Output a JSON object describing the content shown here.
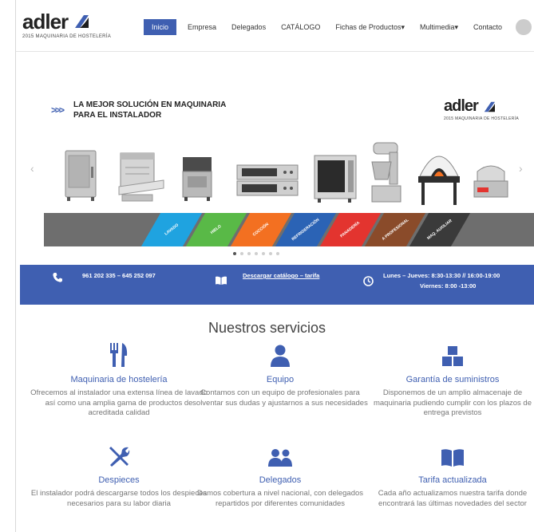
{
  "brand": {
    "name": "adler",
    "tagline": "2015 MAQUINARIA DE HOSTELERÍA"
  },
  "nav": {
    "items": [
      {
        "label": "Inicio",
        "active": true
      },
      {
        "label": "Empresa"
      },
      {
        "label": "Delegados"
      },
      {
        "label": "CATÁLOGO"
      },
      {
        "label": "Fichas de Productos▾"
      },
      {
        "label": "Multimedia▾"
      },
      {
        "label": "Contacto"
      }
    ]
  },
  "banner": {
    "headline_line1": "LA MEJOR SOLUCIÓN EN MAQUINARIA",
    "headline_line2": "PARA EL INSTALADOR",
    "chevrons": ">>>",
    "categories": [
      {
        "label": "LAVADO",
        "color": "#1fa3e0"
      },
      {
        "label": "HIELO",
        "color": "#59b947"
      },
      {
        "label": "COCCIÓN",
        "color": "#f37021"
      },
      {
        "label": "REFRIGERACIÓN",
        "color": "#2b63b5"
      },
      {
        "label": "PANADERÍA",
        "color": "#e3342f"
      },
      {
        "label": "A PROFESIONAL",
        "color": "#8a4b2a"
      },
      {
        "label": "MAQ. AUXILIAR",
        "color": "#3a3a3a"
      }
    ],
    "slides_total": 7,
    "slide_active": 1
  },
  "info": {
    "phone": "961 202 335 – 645 252 097",
    "catalog_link": "Descargar catálogo – tarifa",
    "hours_line1": "Lunes – Jueves: 8:30-13:30 // 16:00-19:00",
    "hours_line2": "Viernes: 8:00 -13:00"
  },
  "services": {
    "title": "Nuestros servicios",
    "items": [
      {
        "title": "Maquinaria de hostelería",
        "desc": "Ofrecemos al instalador una extensa línea de lavado así como una amplia gama de productos de acreditada calidad"
      },
      {
        "title": "Equipo",
        "desc": "Contamos con un equipo de profesionales para solventar sus dudas y ajustarnos a sus necesidades"
      },
      {
        "title": "Garantía de suministros",
        "desc": "Disponemos de un amplio almacenaje de maquinaria pudiendo cumplir con los plazos de entrega previstos"
      },
      {
        "title": "Despieces",
        "desc": "El instalador podrá descargarse todos los despieces necesarios para su labor diaria"
      },
      {
        "title": "Delegados",
        "desc": "Damos cobertura a nivel nacional, con delegados repartidos por diferentes comunidades"
      },
      {
        "title": "Tarifa actualizada",
        "desc": "Cada año actualizamos nuestra tarifa donde encontrará las últimas novedades del sector"
      }
    ]
  },
  "colors": {
    "accent": "#3f5fb1"
  }
}
